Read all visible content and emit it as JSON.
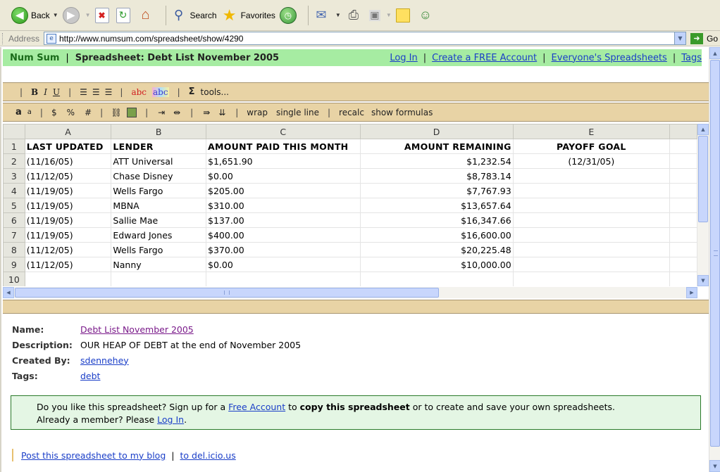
{
  "browser": {
    "toolbar": {
      "back_label": "Back",
      "search_label": "Search",
      "favorites_label": "Favorites"
    },
    "address": {
      "label": "Address",
      "url": "http://www.numsum.com/spreadsheet/show/4290",
      "go_label": "Go"
    }
  },
  "header": {
    "brand": "Num Sum",
    "separator": "|",
    "title": "Spreadsheet: Debt List November 2005",
    "links": [
      "Log In",
      "Create a FREE Account",
      "Everyone's Spreadsheets",
      "Tags"
    ]
  },
  "toolbar1": {
    "bold": "B",
    "italic": "I",
    "underline": "U",
    "abc_color": "abc",
    "abc_highlight": "abc",
    "sigma": "Σ",
    "tools": "tools..."
  },
  "toolbar2": {
    "font_large": "a",
    "font_small": "a",
    "dollar": "$",
    "percent": "%",
    "hash": "#",
    "wrap": "wrap",
    "single_line": "single line",
    "recalc": "recalc",
    "show_formulas": "show formulas"
  },
  "grid": {
    "columns": [
      "A",
      "B",
      "C",
      "D",
      "E"
    ],
    "row_numbers": [
      "1",
      "2",
      "3",
      "4",
      "5",
      "6",
      "7",
      "8",
      "9",
      "10"
    ],
    "headers": [
      "LAST UPDATED",
      "LENDER",
      "AMOUNT PAID THIS MONTH",
      "AMOUNT REMAINING",
      "PAYOFF GOAL"
    ],
    "rows": [
      [
        "(11/16/05)",
        "ATT Universal",
        "$1,651.90",
        "$1,232.54",
        "(12/31/05)"
      ],
      [
        "(11/12/05)",
        "Chase Disney",
        "$0.00",
        "$8,783.14",
        ""
      ],
      [
        "(11/19/05)",
        "Wells Fargo",
        "$205.00",
        "$7,767.93",
        ""
      ],
      [
        "(11/19/05)",
        "MBNA",
        "$310.00",
        "$13,657.64",
        ""
      ],
      [
        "(11/19/05)",
        "Sallie Mae",
        "$137.00",
        "$16,347.66",
        ""
      ],
      [
        "(11/19/05)",
        "Edward Jones",
        "$400.00",
        "$16,600.00",
        ""
      ],
      [
        "(11/12/05)",
        "Wells Fargo",
        "$370.00",
        "$20,225.48",
        ""
      ],
      [
        "(11/12/05)",
        "Nanny",
        "$0.00",
        "$10,000.00",
        ""
      ]
    ]
  },
  "meta": {
    "name_key": "Name:",
    "name_val": "Debt List November 2005",
    "desc_key": "Description:",
    "desc_val": "OUR HEAP OF DEBT at the end of November 2005",
    "created_key": "Created By:",
    "created_val": "sdennehey",
    "tags_key": "Tags:",
    "tags_val": "debt"
  },
  "signup": {
    "text1": "Do you like this spreadsheet? Sign up for a ",
    "link1": "Free Account",
    "text2": " to ",
    "bold": "copy this spreadsheet",
    "text3": " or to create and save your own spreadsheets.",
    "text4": "Already a member? Please ",
    "link2": "Log In",
    "text5": "."
  },
  "share": {
    "blog": "Post this spreadsheet to my blog",
    "sep": "|",
    "delicious": "to del.icio.us"
  },
  "colors": {
    "header_green": "#a6eca2",
    "toolbar_tan": "#e8d3a5",
    "signup_bg": "#e4f6e4",
    "link_blue": "#1a3ec8",
    "link_visited": "#7a1a8a"
  }
}
